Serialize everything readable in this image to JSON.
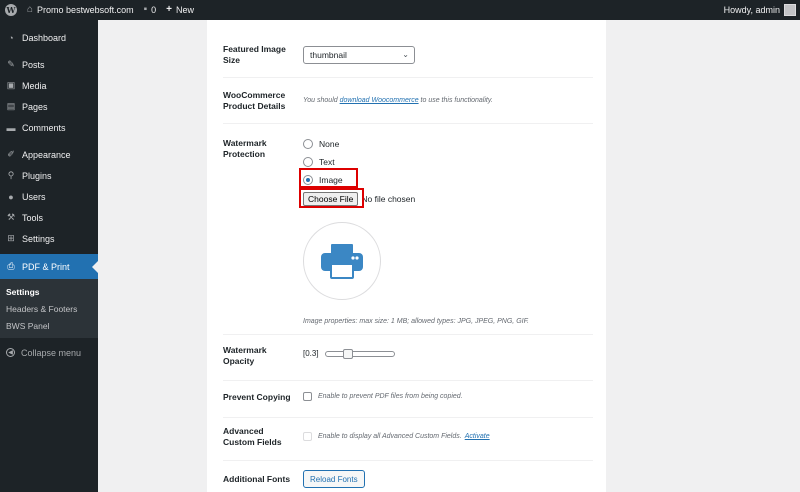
{
  "adminbar": {
    "site_name": "Promo bestwebsoft.com",
    "comments_count": "0",
    "new_label": "New",
    "howdy": "Howdy, admin",
    "wp_logo": "W"
  },
  "sidebar": {
    "items": [
      {
        "label": "Dashboard",
        "icon": "dashboard-icon"
      },
      {
        "label": "Posts",
        "icon": "pin-icon"
      },
      {
        "label": "Media",
        "icon": "media-icon"
      },
      {
        "label": "Pages",
        "icon": "pages-icon"
      },
      {
        "label": "Comments",
        "icon": "comments-icon"
      },
      {
        "label": "Appearance",
        "icon": "appearance-icon"
      },
      {
        "label": "Plugins",
        "icon": "plugins-icon"
      },
      {
        "label": "Users",
        "icon": "users-icon"
      },
      {
        "label": "Tools",
        "icon": "tools-icon"
      },
      {
        "label": "Settings",
        "icon": "settings-icon"
      },
      {
        "label": "PDF & Print",
        "icon": "printer-icon"
      }
    ],
    "submenu": [
      "Settings",
      "Headers & Footers",
      "BWS Panel"
    ],
    "collapse_label": "Collapse menu"
  },
  "form": {
    "featured_image": {
      "label": "Featured Image Size",
      "value": "thumbnail"
    },
    "woocommerce": {
      "label": "WooCommerce Product Details",
      "hint_prefix": "You should",
      "hint_link": "download Woocommerce",
      "hint_suffix": "to use this functionality."
    },
    "watermark": {
      "label": "Watermark Protection",
      "options": [
        "None",
        "Text",
        "Image"
      ],
      "selected": "Image",
      "choose_file": "Choose File",
      "no_file": "No file chosen",
      "image_hint": "Image properties: max size: 1 MB; allowed types: JPG, JPEG, PNG, GIF."
    },
    "opacity": {
      "label": "Watermark Opacity",
      "value": "[0.3]",
      "level": 0.3
    },
    "prevent_copying": {
      "label": "Prevent Copying",
      "hint": "Enable to prevent PDF files from being copied."
    },
    "acf": {
      "label": "Advanced Custom Fields",
      "hint": "Enable to display all Advanced Custom Fields.",
      "link": "Activate"
    },
    "fonts": {
      "label": "Additional Fonts",
      "button": "Reload Fonts"
    }
  },
  "colors": {
    "accent": "#2271b1",
    "admin_bg": "#1d2327",
    "highlight": "#dd0000"
  }
}
